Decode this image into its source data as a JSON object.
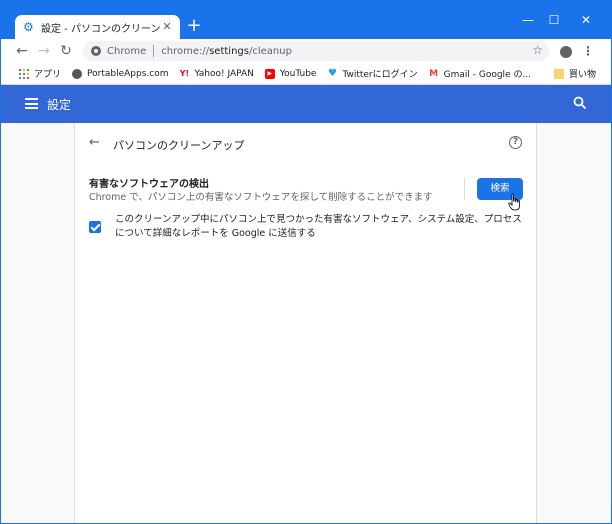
{
  "tab": {
    "title": "設定 - パソコンのクリーンアップ",
    "icon": "gear-icon"
  },
  "window_controls": {
    "minimize": "—",
    "maximize": "☐",
    "close": "✕"
  },
  "omnibox": {
    "site_label": "Chrome",
    "url_prefix": "chrome://",
    "url_path": "settings",
    "url_suffix": "/cleanup"
  },
  "bookmarks": [
    {
      "label": "アプリ",
      "icon": "apps-icon"
    },
    {
      "label": "PortableApps.com",
      "icon": "portableapps-icon"
    },
    {
      "label": "Yahoo! JAPAN",
      "icon": "yahoo-icon"
    },
    {
      "label": "YouTube",
      "icon": "youtube-icon"
    },
    {
      "label": "Twitterにログイン",
      "icon": "twitter-icon"
    },
    {
      "label": "Gmail - Google の...",
      "icon": "gmail-icon"
    },
    {
      "label": "買い物",
      "icon": "folder-icon"
    }
  ],
  "settings_header": {
    "title": "設定"
  },
  "page": {
    "title": "パソコンのクリーンアップ",
    "section_title": "有害なソフトウェアの検出",
    "section_desc": "Chrome で、パソコン上の有害なソフトウェアを探して削除することができます",
    "search_button": "検索",
    "report_checkbox": {
      "checked": true,
      "label": "このクリーンアップ中にパソコン上で見つかった有害なソフトウェア、システム設定、プロセスについて詳細なレポートを Google に送信する"
    }
  },
  "colors": {
    "accent": "#1a73e8",
    "header": "#3367d6"
  }
}
